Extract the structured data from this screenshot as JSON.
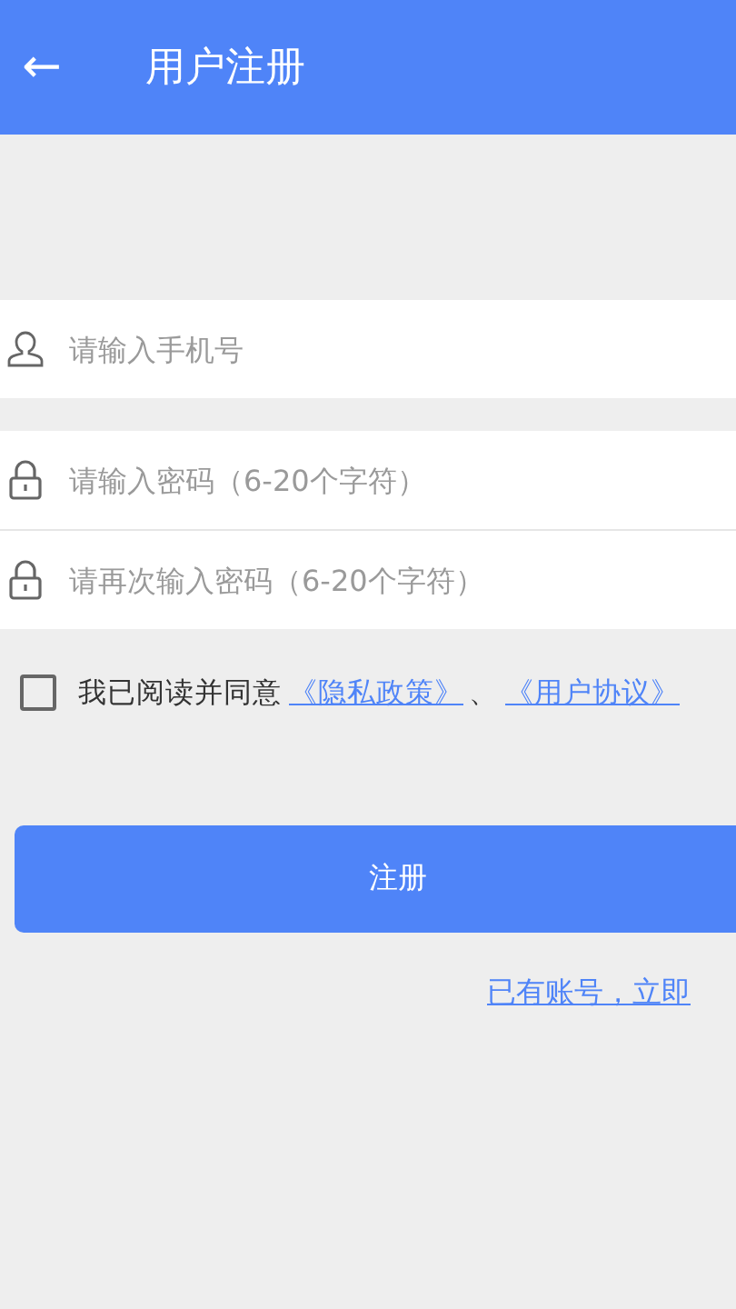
{
  "header": {
    "back": "←",
    "title": "用户注册"
  },
  "fields": [
    {
      "kind": "user",
      "placeholder": "请输入手机号"
    },
    {
      "kind": "lock",
      "placeholder": "请输入密码（6-20个字符）"
    },
    {
      "kind": "lock",
      "placeholder": "请再次输入密码（6-20个字符）"
    }
  ],
  "agreement": {
    "checked": false,
    "text": "我已阅读并同意",
    "links": [
      "《隐私政策》",
      "《用户协议》"
    ],
    "separator": "、"
  },
  "register_button": "注册",
  "login_link": "已有账号，立即"
}
